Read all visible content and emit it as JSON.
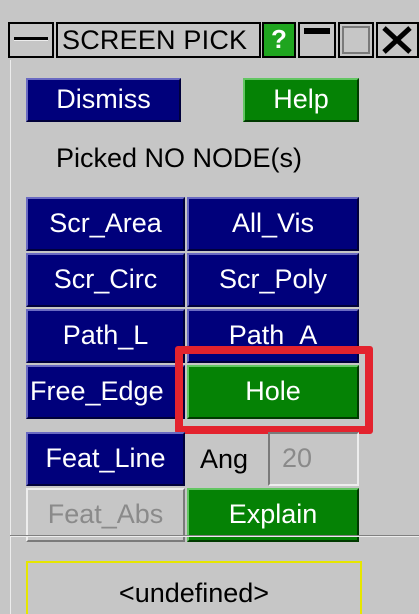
{
  "window": {
    "title": "SCREEN PICK",
    "help_glyph": "?",
    "menu_icon": "window-menu-icon",
    "minimize_icon": "minimize-icon",
    "maximize_icon": "maximize-icon",
    "close_icon": "close-icon"
  },
  "actions": {
    "dismiss": "Dismiss",
    "help": "Help"
  },
  "status": "Picked NO NODE(s)",
  "pick_modes": {
    "scr_area": "Scr_Area",
    "all_vis": "All_Vis",
    "scr_circ": "Scr_Circ",
    "scr_poly": "Scr_Poly",
    "path_l": "Path_L",
    "path_a": "Path_A",
    "free_edge": "Free_Edge",
    "hole": "Hole"
  },
  "feature": {
    "feat_line": "Feat_Line",
    "ang_label": "Ang",
    "ang_value": "20",
    "feat_abs": "Feat_Abs",
    "explain": "Explain"
  },
  "selection_box": "<undefined>",
  "colors": {
    "button_blue": "#00007b",
    "button_green": "#058205",
    "panel_grey": "#c6c6c6",
    "highlight_red": "#e3232e",
    "box_yellow": "#e6e600"
  }
}
